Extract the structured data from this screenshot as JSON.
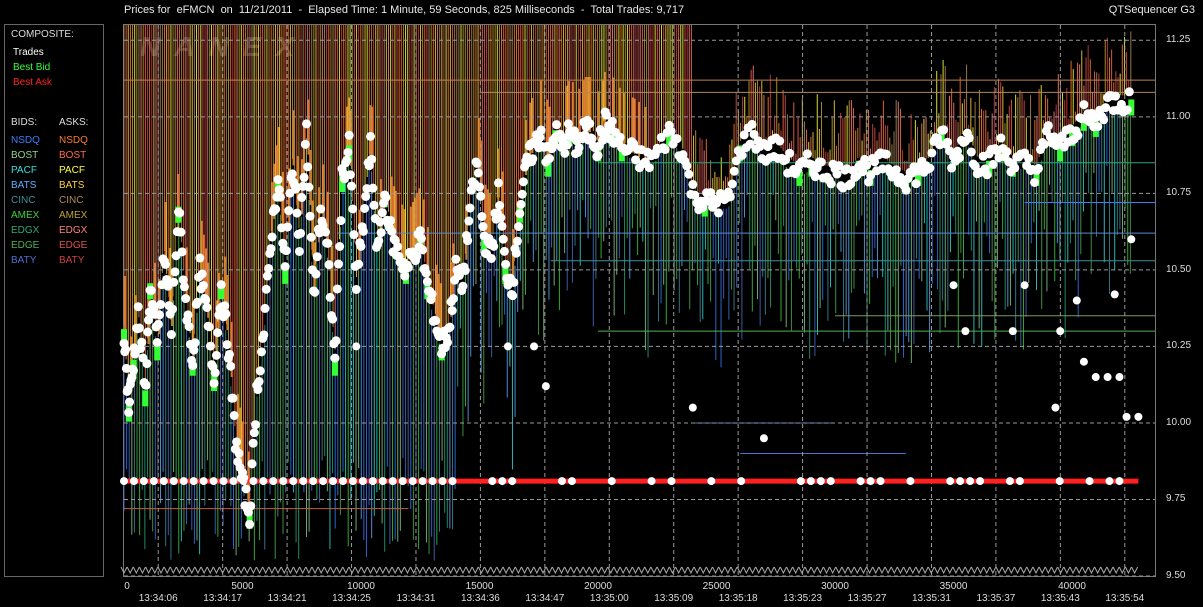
{
  "header": {
    "title": "Prices for  eFMCN  on  11/21/2011  -  Elapsed Time: 1 Minute, 59 Seconds, 825 Milliseconds  -  Total Trades: 9,717",
    "app": "QTSequencer G3"
  },
  "watermark": "NANEX",
  "legend": {
    "composite_label": "COMPOSITE:",
    "trades": "Trades",
    "best_bid": "Best Bid",
    "best_ask": "Best Ask",
    "bids_label": "BIDS:",
    "asks_label": "ASKS:",
    "exchanges": [
      {
        "bid": "NSDQ",
        "ask": "NSDQ",
        "bid_color": "#3a7dff",
        "ask_color": "#ff7a2a"
      },
      {
        "bid": "BOST",
        "ask": "BOST",
        "bid_color": "#8fd18f",
        "ask_color": "#ff6a4a"
      },
      {
        "bid": "PACF",
        "ask": "PACF",
        "bid_color": "#35e0e0",
        "ask_color": "#ffff40"
      },
      {
        "bid": "BATS",
        "ask": "BATS",
        "bid_color": "#60b0ff",
        "ask_color": "#ffd040"
      },
      {
        "bid": "CINC",
        "ask": "CINC",
        "bid_color": "#3f8fa0",
        "ask_color": "#b08a5a"
      },
      {
        "bid": "AMEX",
        "ask": "AMEX",
        "bid_color": "#40d040",
        "ask_color": "#c0a030"
      },
      {
        "bid": "EDGX",
        "ask": "EDGX",
        "bid_color": "#2aa880",
        "ask_color": "#ff8080"
      },
      {
        "bid": "EDGE",
        "ask": "EDGE",
        "bid_color": "#50b050",
        "ask_color": "#e05050"
      },
      {
        "bid": "BATY",
        "ask": "BATY",
        "bid_color": "#4a70d0",
        "ask_color": "#d04040"
      }
    ]
  },
  "colors": {
    "trades": "#ffffff",
    "best_bid": "#33ff33",
    "best_ask": "#ff2020",
    "background": "#000000",
    "grid": "#9a9a9a"
  },
  "chart_data": {
    "type": "scatter",
    "title": "",
    "ylim": [
      9.5,
      11.3
    ],
    "xlim": [
      0,
      43500
    ],
    "y_ticks": [
      "9.50",
      "9.75",
      "10.00",
      "10.25",
      "10.50",
      "10.75",
      "11.00",
      "11.25"
    ],
    "x_ticks": [
      "0",
      "5000",
      "10000",
      "15000",
      "20000",
      "25000",
      "30000",
      "35000",
      "40000"
    ],
    "time_labels": [
      "13:34:06",
      "13:34:17",
      "13:34:21",
      "13:34:25",
      "13:34:31",
      "13:34:36",
      "13:34:47",
      "13:35:00",
      "13:35:09",
      "13:35:18",
      "13:35:23",
      "13:35:27",
      "13:35:31",
      "13:35:37",
      "13:35:43",
      "13:35:54"
    ],
    "best_ask_line": 9.81,
    "trade_series": [
      [
        0,
        10.3
      ],
      [
        200,
        10.05
      ],
      [
        400,
        10.2
      ],
      [
        600,
        10.35
      ],
      [
        900,
        10.1
      ],
      [
        1100,
        10.45
      ],
      [
        1400,
        10.25
      ],
      [
        1700,
        10.55
      ],
      [
        2000,
        10.3
      ],
      [
        2300,
        10.7
      ],
      [
        2600,
        10.4
      ],
      [
        2900,
        10.2
      ],
      [
        3200,
        10.5
      ],
      [
        3500,
        10.35
      ],
      [
        3800,
        10.15
      ],
      [
        4100,
        10.45
      ],
      [
        4400,
        10.25
      ],
      [
        4700,
        9.95
      ],
      [
        5000,
        9.8
      ],
      [
        5300,
        9.7
      ],
      [
        5600,
        10.1
      ],
      [
        5900,
        10.3
      ],
      [
        6200,
        10.6
      ],
      [
        6500,
        10.8
      ],
      [
        6800,
        10.5
      ],
      [
        7100,
        10.85
      ],
      [
        7400,
        10.6
      ],
      [
        7700,
        10.95
      ],
      [
        8000,
        10.4
      ],
      [
        8300,
        10.7
      ],
      [
        8600,
        10.55
      ],
      [
        8900,
        10.2
      ],
      [
        9200,
        10.8
      ],
      [
        9500,
        10.9
      ],
      [
        9800,
        10.45
      ],
      [
        10100,
        10.65
      ],
      [
        10400,
        10.9
      ],
      [
        10700,
        10.55
      ],
      [
        11000,
        10.75
      ],
      [
        11300,
        10.6
      ],
      [
        11600,
        10.55
      ],
      [
        11900,
        10.5
      ],
      [
        12200,
        10.55
      ],
      [
        12500,
        10.6
      ],
      [
        12800,
        10.45
      ],
      [
        13100,
        10.35
      ],
      [
        13400,
        10.25
      ],
      [
        13700,
        10.3
      ],
      [
        14000,
        10.5
      ],
      [
        14300,
        10.45
      ],
      [
        14600,
        10.7
      ],
      [
        14900,
        10.85
      ],
      [
        15200,
        10.6
      ],
      [
        15500,
        10.55
      ],
      [
        15800,
        10.75
      ],
      [
        16100,
        10.5
      ],
      [
        16400,
        10.45
      ],
      [
        16700,
        10.7
      ],
      [
        17000,
        10.85
      ],
      [
        17300,
        10.9
      ],
      [
        17600,
        10.95
      ],
      [
        17900,
        10.85
      ],
      [
        18200,
        10.95
      ],
      [
        18500,
        10.9
      ],
      [
        18800,
        10.95
      ],
      [
        19100,
        10.9
      ],
      [
        19400,
        10.95
      ],
      [
        19700,
        10.95
      ],
      [
        20000,
        10.9
      ],
      [
        20300,
        10.98
      ],
      [
        20600,
        10.95
      ],
      [
        21000,
        10.9
      ],
      [
        21500,
        10.88
      ],
      [
        22000,
        10.85
      ],
      [
        22500,
        10.88
      ],
      [
        23000,
        10.95
      ],
      [
        23500,
        10.9
      ],
      [
        24000,
        10.75
      ],
      [
        24500,
        10.72
      ],
      [
        25000,
        10.72
      ],
      [
        25500,
        10.72
      ],
      [
        26000,
        10.9
      ],
      [
        26500,
        10.95
      ],
      [
        27000,
        10.88
      ],
      [
        27500,
        10.9
      ],
      [
        28000,
        10.85
      ],
      [
        28500,
        10.82
      ],
      [
        29000,
        10.85
      ],
      [
        29500,
        10.82
      ],
      [
        30000,
        10.82
      ],
      [
        30500,
        10.8
      ],
      [
        31000,
        10.85
      ],
      [
        31500,
        10.82
      ],
      [
        32000,
        10.85
      ],
      [
        32500,
        10.82
      ],
      [
        33000,
        10.8
      ],
      [
        33500,
        10.82
      ],
      [
        34000,
        10.85
      ],
      [
        34500,
        10.95
      ],
      [
        35000,
        10.85
      ],
      [
        35500,
        10.95
      ],
      [
        36000,
        10.85
      ],
      [
        36500,
        10.85
      ],
      [
        37000,
        10.9
      ],
      [
        37500,
        10.85
      ],
      [
        38000,
        10.85
      ],
      [
        38500,
        10.82
      ],
      [
        39000,
        10.95
      ],
      [
        39500,
        10.9
      ],
      [
        40000,
        10.95
      ],
      [
        40500,
        11.0
      ],
      [
        41000,
        10.98
      ],
      [
        41500,
        11.05
      ],
      [
        42000,
        11.05
      ],
      [
        42500,
        11.05
      ]
    ],
    "isolated_trades": [
      [
        24000,
        10.05
      ],
      [
        27000,
        9.95
      ],
      [
        35000,
        10.45
      ],
      [
        35500,
        10.3
      ],
      [
        37500,
        10.3
      ],
      [
        39500,
        10.3
      ],
      [
        40200,
        10.4
      ],
      [
        41000,
        10.15
      ],
      [
        41500,
        10.15
      ],
      [
        42000,
        10.15
      ],
      [
        42300,
        10.02
      ],
      [
        42800,
        10.02
      ],
      [
        39300,
        10.05
      ],
      [
        40500,
        10.2
      ],
      [
        41800,
        10.42
      ],
      [
        42500,
        10.6
      ],
      [
        38000,
        10.45
      ],
      [
        9800,
        10.25
      ],
      [
        16200,
        10.25
      ],
      [
        17300,
        10.25
      ],
      [
        17800,
        10.12
      ]
    ]
  }
}
